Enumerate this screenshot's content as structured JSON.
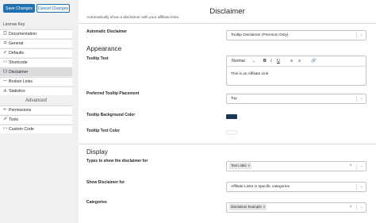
{
  "topbar": {
    "save_label": "Save Changes",
    "cancel_label": "Cancel Changes"
  },
  "sidebar": {
    "license_key": "License Key",
    "items": [
      {
        "label": "Documentation",
        "icon": "document-icon"
      },
      {
        "label": "General",
        "icon": "gear-icon"
      },
      {
        "label": "Defaults",
        "icon": "pencil-icon"
      },
      {
        "label": "Shortcode",
        "icon": "shortcode-icon"
      },
      {
        "label": "Disclaimer",
        "icon": "disclaimer-icon"
      },
      {
        "label": "Broken Links",
        "icon": "broken-link-icon"
      },
      {
        "label": "Statistics",
        "icon": "chart-icon"
      }
    ],
    "advanced_label": "Advanced",
    "advanced_items": [
      {
        "label": "Permissions",
        "icon": "key-icon"
      },
      {
        "label": "Tools",
        "icon": "wrench-icon"
      },
      {
        "label": "Custom Code",
        "icon": "code-icon"
      }
    ]
  },
  "main": {
    "title": "Disclaimer",
    "description": "Automatically show a disclaimer with your affiliate links.",
    "automatic_disclaimer": {
      "label": "Automatic Disclaimer",
      "value": "Tooltip Disclaimer (Premium Only)"
    },
    "appearance_heading": "Appearance",
    "tooltip_text": {
      "label": "Tooltip Text",
      "toolbar_format": "Normal",
      "value": "This is an Affiliate Link"
    },
    "placement": {
      "label": "Preferred Tooltip Placement",
      "value": "Top"
    },
    "bg_color": {
      "label": "Tooltip Background Color",
      "color": "#1c3553"
    },
    "text_color": {
      "label": "Tooltip Text Color",
      "color": "#ffffff"
    },
    "display_heading": "Display",
    "types": {
      "label": "Types to show the disclaimer for",
      "tag": "Text Links"
    },
    "show_for": {
      "label": "Show Disclaimer for",
      "value": "Affiliate Links in specific categories"
    },
    "categories": {
      "label": "Categories",
      "tag": "Disclaimer Example"
    }
  },
  "colors": {
    "accent": "#2271b1",
    "active_menu": "#dcdcde"
  }
}
